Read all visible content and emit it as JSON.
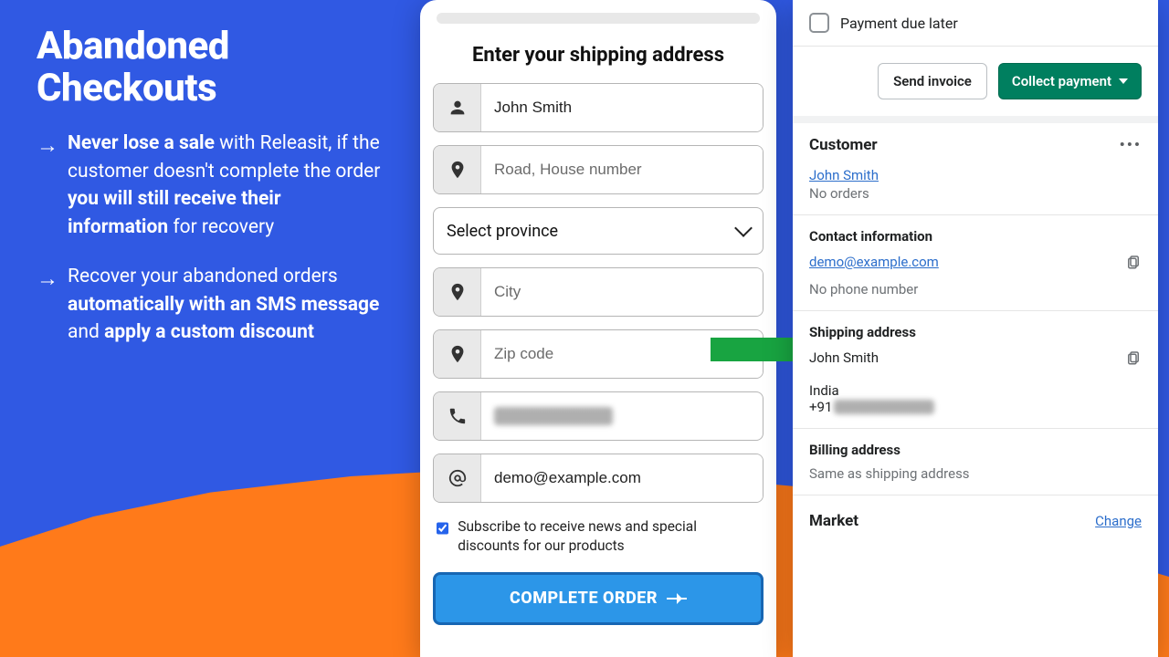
{
  "promo": {
    "heading_l1": "Abandoned",
    "heading_l2": "Checkouts",
    "b1": {
      "bold1": "Never lose a sale",
      "t1": "with Releasit, if the customer doesn't complete the order",
      "bold2": "you will still receive their information",
      "t2": "for recovery"
    },
    "b2": {
      "t1": "Recover your abandoned orders",
      "bold1": "automatically with an SMS message",
      "t2": "and",
      "bold2": "apply a custom discount"
    }
  },
  "form": {
    "title": "Enter your shipping address",
    "name": "John Smith",
    "address_ph": "Road, House number",
    "province": "Select province",
    "city_ph": "City",
    "zip_ph": "Zip code",
    "email": "demo@example.com",
    "subscribe": "Subscribe to receive news and special discounts for our products",
    "cta": "COMPLETE ORDER"
  },
  "admin": {
    "payment_due_later": "Payment due later",
    "send_invoice": "Send invoice",
    "collect_payment": "Collect payment",
    "customer_h": "Customer",
    "customer_name": "John Smith",
    "orders": "No orders",
    "contact_h": "Contact information",
    "email": "demo@example.com",
    "no_phone": "No phone number",
    "shipping_h": "Shipping address",
    "ship_name": "John Smith",
    "ship_country": "India",
    "ship_phone_prefix": "+91",
    "billing_h": "Billing address",
    "billing_same": "Same as shipping address",
    "market_h": "Market",
    "change": "Change"
  }
}
